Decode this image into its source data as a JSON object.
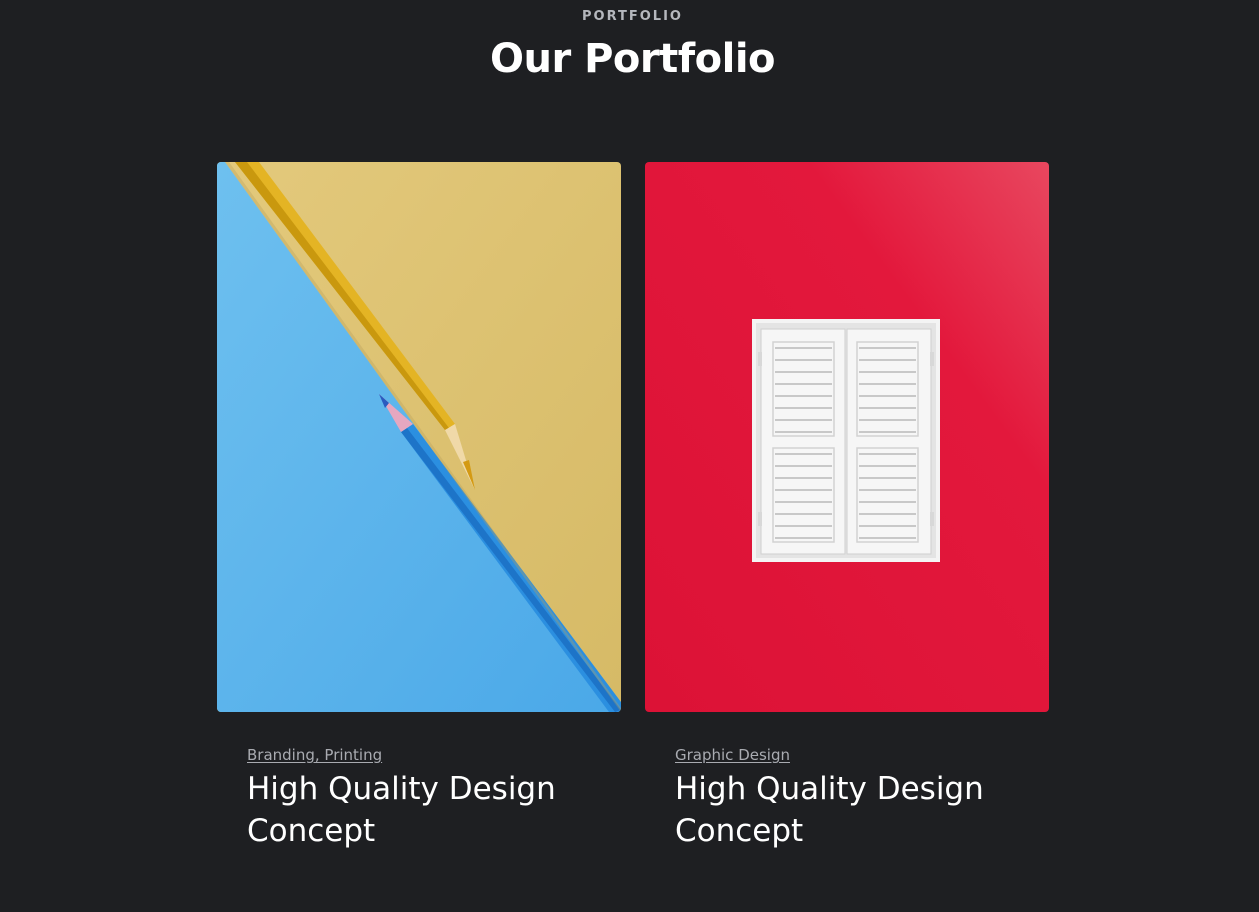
{
  "section": {
    "eyebrow": "PORTFOLIO",
    "heading": "Our Portfolio"
  },
  "items": [
    {
      "category": "Branding, Printing",
      "title": "High Quality Design Concept",
      "image": "pencils-photo",
      "colors": {
        "blue": "#5fb8ec",
        "yellow": "#dcc172",
        "pencil_yellow": "#e0b21e",
        "pencil_blue": "#2f8fe0"
      }
    },
    {
      "category": "Graphic Design",
      "title": "High Quality Design Concept",
      "image": "shutter-window-photo",
      "colors": {
        "red": "#e0163a",
        "white": "#f2f2f2"
      }
    }
  ],
  "theme": {
    "background": "#1e1f22",
    "muted_text": "#a9abb1"
  }
}
